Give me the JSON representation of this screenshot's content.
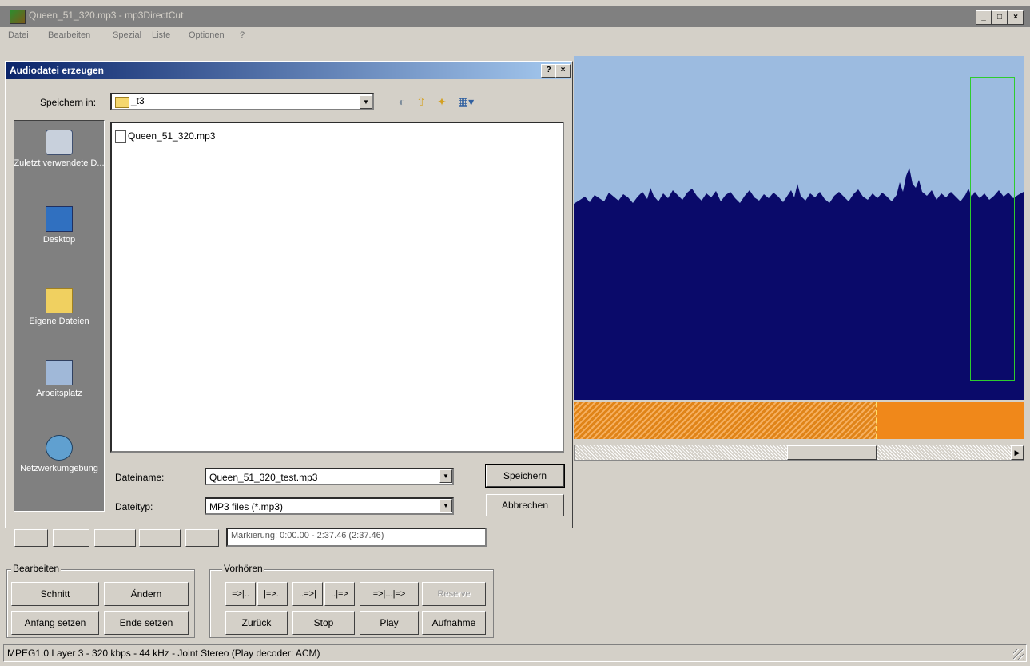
{
  "window": {
    "title": "Queen_51_320.mp3 - mp3DirectCut",
    "minimize": "_",
    "maximize": "□",
    "close": "×"
  },
  "menu": [
    "Datei",
    "Bearbeiten",
    "Spezial",
    "Liste",
    "Optionen",
    "?"
  ],
  "dialog": {
    "title": "Audiodatei erzeugen",
    "help_btn": "?",
    "close_btn": "×",
    "save_in_label": "Speichern in:",
    "save_in_value": "_t3",
    "places": [
      "Zuletzt verwendete D...",
      "Desktop",
      "Eigene Dateien",
      "Arbeitsplatz",
      "Netzwerkumgebung"
    ],
    "files": [
      "Queen_51_320.mp3"
    ],
    "filename_label": "Dateiname:",
    "filename_value": "Queen_51_320_test.mp3",
    "filetype_label": "Dateityp:",
    "filetype_value": "MP3 files (*.mp3)",
    "save_button": "Speichern",
    "cancel_button": "Abbrechen"
  },
  "marker_text": "Markierung: 0:00.00 - 2:37.46 (2:37.46)",
  "bearbeiten": {
    "label": "Bearbeiten",
    "cut": "Schnitt",
    "change": "Ändern",
    "set_start": "Anfang setzen",
    "set_end": "Ende setzen"
  },
  "vorhoeren": {
    "label": "Vorhören",
    "b1": "=>|..",
    "b2": "|=>..",
    "b3": "..=>|",
    "b4": "..|=>",
    "b5": "=>|...|=>",
    "reserve": "Reserve",
    "back": "Zurück",
    "stop": "Stop",
    "play": "Play",
    "record": "Aufnahme"
  },
  "status": "MPEG1.0 Layer 3 - 320 kbps - 44 kHz - Joint Stereo   (Play decoder: ACM)",
  "colors": {
    "wave_bg": "#9cbbe0",
    "wave_fill": "#0a0a6a",
    "selection": "#2ecc2e",
    "orange": "#f0881a"
  }
}
